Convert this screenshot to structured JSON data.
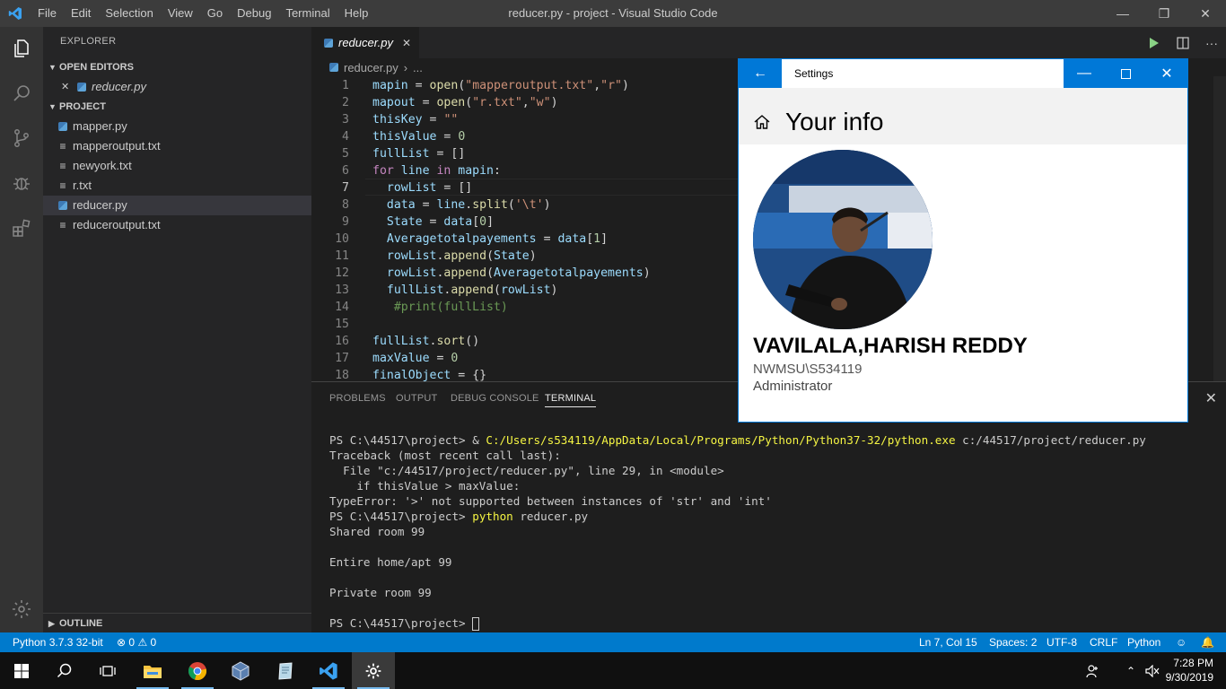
{
  "titlebar": {
    "menu": [
      "File",
      "Edit",
      "Selection",
      "View",
      "Go",
      "Debug",
      "Terminal",
      "Help"
    ],
    "window_title": "reducer.py - project - Visual Studio Code"
  },
  "sidebar": {
    "title": "EXPLORER",
    "open_editors_label": "OPEN EDITORS",
    "open_editor_file": "reducer.py",
    "project_label": "PROJECT",
    "files": [
      {
        "name": "mapper.py",
        "icon": "python-file-icon"
      },
      {
        "name": "mapperoutput.txt",
        "icon": "text-file-icon"
      },
      {
        "name": "newyork.txt",
        "icon": "text-file-icon"
      },
      {
        "name": "r.txt",
        "icon": "text-file-icon"
      },
      {
        "name": "reducer.py",
        "icon": "python-file-icon",
        "selected": true
      },
      {
        "name": "reduceroutput.txt",
        "icon": "text-file-icon"
      }
    ],
    "outline_label": "OUTLINE"
  },
  "editor": {
    "tab_label": "reducer.py",
    "breadcrumb_file": "reducer.py",
    "breadcrumb_more": "...",
    "current_line": 7,
    "lines": [
      "mapin = open(\"mapperoutput.txt\",\"r\")",
      "mapout = open(\"r.txt\",\"w\")",
      "thisKey = \"\"",
      "thisValue = 0",
      "fullList = []",
      "for line in mapin:",
      "  rowList = []",
      "  data = line.split('\\t')",
      "  State = data[0]",
      "  Averagetotalpayements = data[1]",
      "  rowList.append(State)",
      "  rowList.append(Averagetotalpayements)",
      "  fullList.append(rowList)",
      "   #print(fullList)",
      "",
      "fullList.sort()",
      "maxValue = 0",
      "finalObject = {}"
    ]
  },
  "panel": {
    "tabs": [
      "PROBLEMS",
      "OUTPUT",
      "DEBUG CONSOLE",
      "TERMINAL"
    ],
    "active_tab": "TERMINAL",
    "terminal": {
      "l1_prompt": "PS C:\\44517\\project> & ",
      "l1_exe": "C:/Users/s534119/AppData/Local/Programs/Python/Python37-32/python.exe",
      "l1_arg": " c:/44517/project/reducer.py",
      "l2": "Traceback (most recent call last):",
      "l3": "  File \"c:/44517/project/reducer.py\", line 29, in <module>",
      "l4": "    if thisValue > maxValue:",
      "l5": "TypeError: '>' not supported between instances of 'str' and 'int'",
      "l6_prompt": "PS C:\\44517\\project> ",
      "l6_cmd": "python",
      "l6_arg": " reducer.py",
      "l7": "Shared room 99",
      "l8": "Entire home/apt 99",
      "l9": "Private room 99",
      "l10_prompt": "PS C:\\44517\\project> "
    }
  },
  "statusbar": {
    "interpreter": "Python 3.7.3 32-bit",
    "errors": "0",
    "warnings": "0",
    "position": "Ln 7, Col 15",
    "spaces": "Spaces: 2",
    "encoding": "UTF-8",
    "eol": "CRLF",
    "language": "Python"
  },
  "settings_window": {
    "title": "Settings",
    "heading": "Your info",
    "user_name": "VAVILALA,HARISH REDDY",
    "account": "NWMSU\\S534119",
    "role": "Administrator",
    "accent": "#0078d7"
  },
  "taskbar": {
    "time": "7:28 PM",
    "date": "9/30/2019",
    "apps": [
      "start-icon",
      "search-icon",
      "task-view-icon",
      "file-explorer-icon",
      "chrome-icon",
      "virtualbox-icon",
      "notepad-icon",
      "vscode-icon",
      "settings-icon"
    ]
  },
  "colors": {
    "statusbar": "#007acc",
    "editor_bg": "#1e1e1e",
    "sidebar_bg": "#252526",
    "activitybar_bg": "#333333"
  }
}
